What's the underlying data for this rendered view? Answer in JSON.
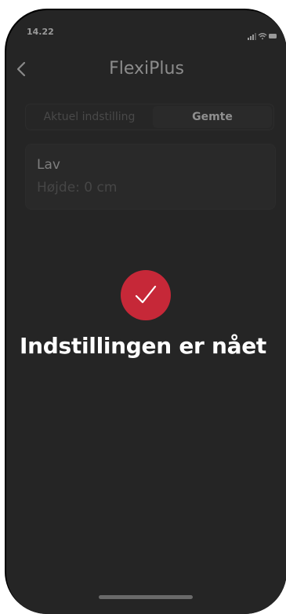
{
  "status_bar": {
    "time": "14.22",
    "icons": [
      "signal-icon",
      "wifi-icon",
      "battery-icon"
    ]
  },
  "nav": {
    "title": "FlexiPlus",
    "back_icon": "chevron-left-icon"
  },
  "tabs": [
    {
      "label": "Aktuel indstilling",
      "selected": false
    },
    {
      "label": "Gemte",
      "selected": true
    }
  ],
  "saved_setting": {
    "name": "Lav",
    "height_text": "Højde: 0 cm"
  },
  "toast": {
    "icon": "checkmark-icon",
    "message": "Indstillingen er nået"
  },
  "colors": {
    "screen_background": "#252525",
    "success_badge": "#c62838",
    "toast_text": "#ffffff"
  }
}
